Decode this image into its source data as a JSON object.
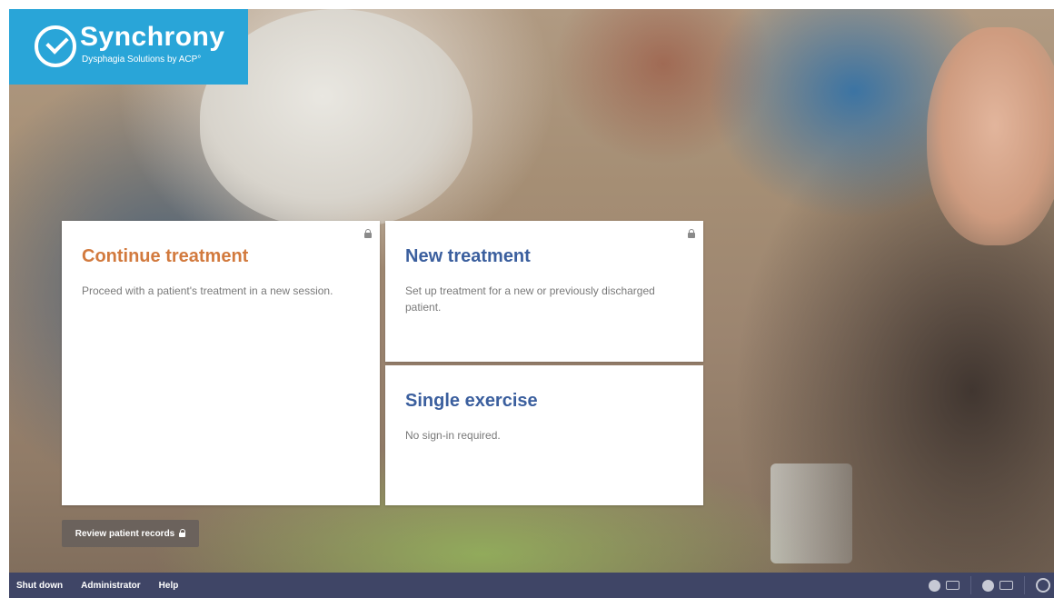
{
  "brand": {
    "name": "Synchrony",
    "tagline": "Dysphagia Solutions by ACP°",
    "color": "#29a5d8"
  },
  "cards": {
    "continue": {
      "title": "Continue treatment",
      "description": "Proceed with a patient's treatment in a new session.",
      "title_color": "#d27a3e",
      "icon": "lock-icon"
    },
    "new": {
      "title": "New treatment",
      "description": "Set up treatment for a new or previously discharged patient.",
      "title_color": "#3b5f9e",
      "icon": "lock-icon"
    },
    "single": {
      "title": "Single exercise",
      "description": "No sign-in required.",
      "title_color": "#3b5f9e"
    }
  },
  "review": {
    "label": "Review patient records",
    "icon": "lock-icon"
  },
  "taskbar": {
    "shutdown": "Shut down",
    "administrator": "Administrator",
    "help": "Help",
    "background": "#3f4566",
    "tray_icons": [
      "info-icon",
      "battery-icon",
      "network-icon",
      "battery-icon",
      "help-ring-icon"
    ]
  }
}
